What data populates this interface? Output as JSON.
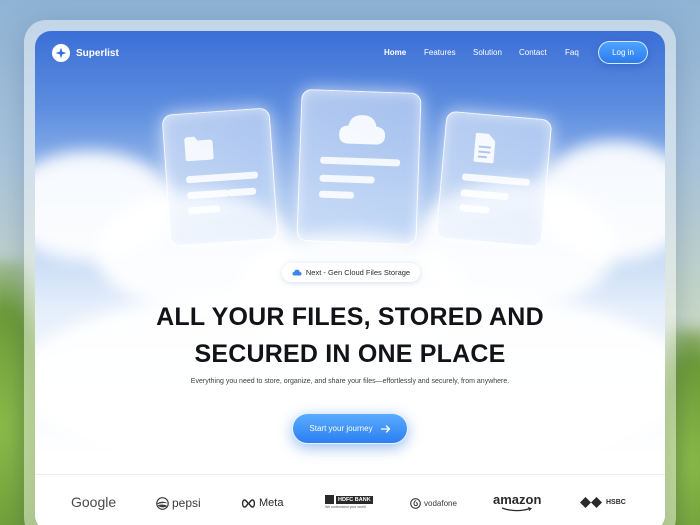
{
  "brand": {
    "name": "Superlist"
  },
  "nav": {
    "links": [
      "Home",
      "Features",
      "Solution",
      "Contact",
      "Faq"
    ],
    "login_label": "Log in"
  },
  "hero": {
    "badge": "Next - Gen Cloud Files Storage",
    "headline_line1": "ALL YOUR FILES, STORED AND",
    "headline_line2": "SECURED IN ONE PLACE",
    "subtitle": "Everything you need to store, organize, and share your files—effortlessly and securely, from anywhere.",
    "cta_label": "Start your journey"
  },
  "cards": [
    {
      "icon": "folder-icon"
    },
    {
      "icon": "cloud-icon"
    },
    {
      "icon": "document-icon"
    }
  ],
  "partners": {
    "google": "Google",
    "pepsi": "pepsi",
    "meta": "Meta",
    "hdfc": "HDFC BANK",
    "hdfc_tagline": "We understand your world",
    "vodafone": "vodafone",
    "amazon": "amazon",
    "hsbc": "HSBC"
  },
  "colors": {
    "accent": "#2b7ff2",
    "sky_top": "#3b6fd6",
    "text_dark": "#121318"
  }
}
